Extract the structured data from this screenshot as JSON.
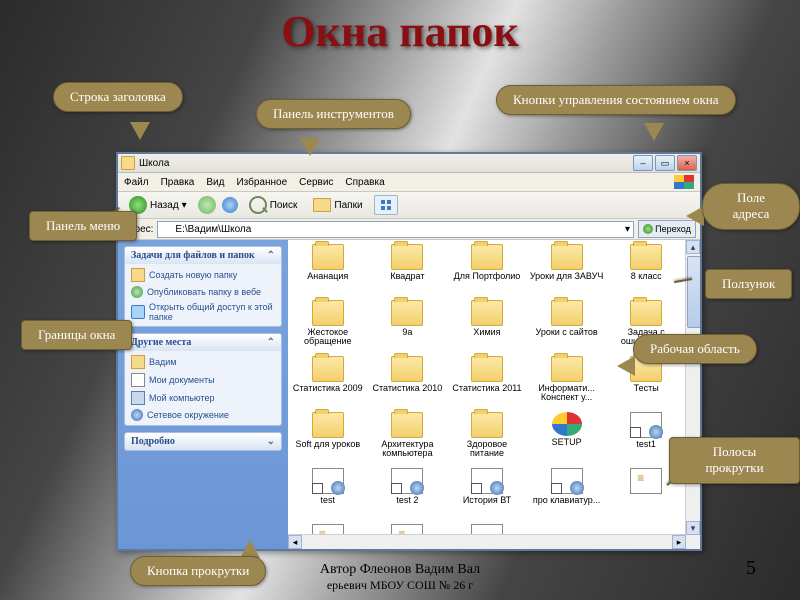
{
  "slide": {
    "title": "Окна папок",
    "author_line": "Автор Флеонов Вадим Вал",
    "author_line2": "ерьевич МБОУ СОШ № 26 г",
    "page_number": "5"
  },
  "labels": {
    "titlebar": "Строка заголовка",
    "toolbar": "Панель инструментов",
    "caption_btns": "Кнопки управления состоянием окна",
    "addr_field": "Поле адреса",
    "menubar": "Панель меню",
    "slider": "Ползунок",
    "borders": "Границы окна",
    "workarea": "Рабочая область",
    "scrollbars": "Полосы прокрутки",
    "scroll_btn": "Кнопка прокрутки"
  },
  "window": {
    "title": "Школа",
    "menus": [
      "Файл",
      "Правка",
      "Вид",
      "Избранное",
      "Сервис",
      "Справка"
    ],
    "toolbar": {
      "back": "Назад",
      "search": "Поиск",
      "folders": "Папки"
    },
    "addr": {
      "label": "Адрес:",
      "value": "E:\\Вадим\\Школа",
      "go": "Переход"
    },
    "sidebar": {
      "tasks_header": "Задачи для файлов и папок",
      "tasks": [
        {
          "icon": "new",
          "text": "Создать новую папку"
        },
        {
          "icon": "web",
          "text": "Опубликовать папку в вебе"
        },
        {
          "icon": "share",
          "text": "Открыть общий доступ к этой папке"
        }
      ],
      "places_header": "Другие места",
      "places": [
        {
          "icon": "fld",
          "text": "Вадим"
        },
        {
          "icon": "doc",
          "text": "Мои документы"
        },
        {
          "icon": "comp",
          "text": "Мой компьютер"
        },
        {
          "icon": "net",
          "text": "Сетевое окружение"
        }
      ],
      "details_header": "Подробно"
    },
    "items": [
      {
        "icon": "folder",
        "name": "Ананация"
      },
      {
        "icon": "folder",
        "name": "Квадрат"
      },
      {
        "icon": "folder",
        "name": "Для Портфолио"
      },
      {
        "icon": "folder",
        "name": "Уроки для ЗАВУЧ"
      },
      {
        "icon": "folder",
        "name": "8 класс"
      },
      {
        "icon": "folder",
        "name": "Жестокое обращение"
      },
      {
        "icon": "folder",
        "name": "9а"
      },
      {
        "icon": "folder",
        "name": "Химия"
      },
      {
        "icon": "folder",
        "name": "Уроки с сайтов"
      },
      {
        "icon": "folder",
        "name": "Задача с ошибкой УВ"
      },
      {
        "icon": "folder",
        "name": "Статистика 2009"
      },
      {
        "icon": "folder",
        "name": "Статистика 2010"
      },
      {
        "icon": "folder",
        "name": "Статистика 2011"
      },
      {
        "icon": "folder",
        "name": "Информати... Конспект у..."
      },
      {
        "icon": "folder",
        "name": "Тесты"
      },
      {
        "icon": "folder",
        "name": "Soft для уроков"
      },
      {
        "icon": "folder",
        "name": "Архитектура компьютера"
      },
      {
        "icon": "folder",
        "name": "Здоровое питание"
      },
      {
        "icon": "setup",
        "name": "SETUP"
      },
      {
        "icon": "shortcut",
        "name": "test1"
      },
      {
        "icon": "shortcut",
        "name": "test"
      },
      {
        "icon": "shortcut",
        "name": "test 2"
      },
      {
        "icon": "shortcut",
        "name": "История ВТ"
      },
      {
        "icon": "shortcut",
        "name": "про клавиатур..."
      },
      {
        "icon": "tmpl",
        "name": ""
      },
      {
        "icon": "tmpl",
        "name": ""
      },
      {
        "icon": "tmpl",
        "name": ""
      },
      {
        "icon": "word",
        "name": ""
      }
    ]
  }
}
